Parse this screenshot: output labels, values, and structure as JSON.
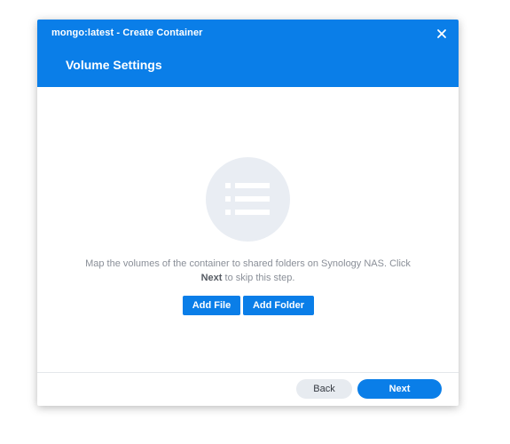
{
  "dialog": {
    "window_title": "mongo:latest - Create Container",
    "step_title": "Volume Settings",
    "close_icon": "close-icon",
    "illustration_icon": "list-icon",
    "message_part1": "Map the volumes of the container to shared folders on Synology NAS. Click",
    "message_bold": "Next",
    "message_part2": " to skip this step.",
    "add_file_label": "Add File",
    "add_folder_label": "Add Folder",
    "back_label": "Back",
    "next_label": "Next"
  },
  "colors": {
    "accent": "#0a7ee8",
    "illustration_bg": "#e9edf3",
    "secondary_button_bg": "#e7ebf0",
    "message_text": "#8a8f98"
  }
}
